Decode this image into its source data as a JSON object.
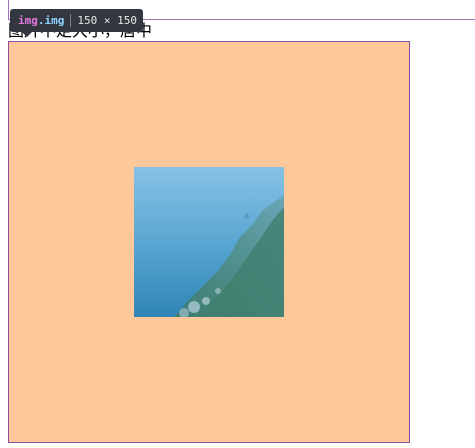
{
  "page": {
    "heading": "图片不定大小，居中"
  },
  "devtools_tooltip": {
    "tag": "img",
    "class": ".img",
    "size": "150 × 150"
  },
  "colors": {
    "container_bg": "#fec89a",
    "container_border": "#8a4f9e",
    "tooltip_bg": "#333740",
    "tooltip_tag": "#e777e0",
    "tooltip_class": "#8fd4ff"
  },
  "image": {
    "description_icon": "coastal-landscape-image"
  }
}
